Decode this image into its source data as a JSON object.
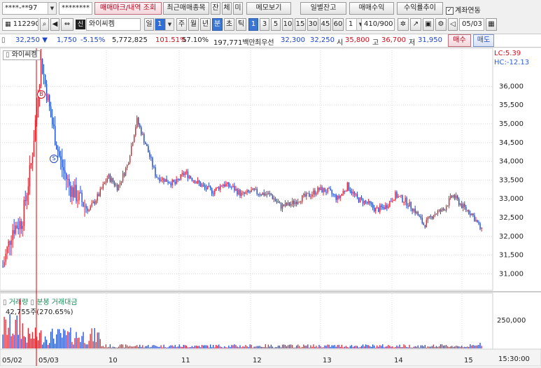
{
  "toolbar1": {
    "account": "****-**97",
    "password": "********",
    "btn_history": "매매마크/내역 조회",
    "btn_recent": "최근매매종목",
    "btn_jan": "잔",
    "btn_che": "체",
    "btn_mi": "미",
    "btn_memo": "메모보기",
    "btn_daily": "일별잔고",
    "btn_profit": "매매수익",
    "btn_return": "수익률추이",
    "chk_linked": "계좌연동"
  },
  "toolbar2": {
    "code": "112290",
    "badge": "신",
    "stock_name": "와이씨켐",
    "period_il": "일",
    "period_num": "1",
    "periods": [
      "주",
      "월",
      "년",
      "분",
      "초",
      "틱"
    ],
    "intervals": [
      "1",
      "3",
      "5",
      "10",
      "15",
      "30",
      "45",
      "60"
    ],
    "unit_value": "1",
    "count": "410/900",
    "date": "05/03"
  },
  "info": {
    "price": "32,250",
    "arrow": "▼",
    "change": "1,750",
    "pct": "-5.15%",
    "volume": "5,772,825",
    "ratio1": "101.51%",
    "ratio2": "57.10%",
    "amount": "197,771백만",
    "quote_label": "최우선",
    "ask": "32,300",
    "bid": "32,250",
    "open_label": "시",
    "open": "35,800",
    "high_label": "고",
    "high": "36,700",
    "low_label": "저",
    "low": "31,950",
    "buy_button": "매수",
    "sell_button": "매도"
  },
  "chart": {
    "stock_label": "와이씨켐",
    "lc": "LC:5.39",
    "hc": "HC:-12.13",
    "buy_marker": "B",
    "sell_marker": "S",
    "vol_label": "거래량",
    "amt_label": "분봉 거래대금",
    "vol_value": "42,755주(270.65%)",
    "vol_tick": "250,000",
    "x_last": "15:30:00"
  },
  "chart_data": {
    "type": "candlestick",
    "y_ticks": [
      31000,
      31500,
      32000,
      32500,
      33000,
      33500,
      34000,
      34500,
      35000,
      35500,
      36000
    ],
    "ylim": [
      30600,
      36900
    ],
    "x_tick_labels": [
      "05/02",
      "05/03",
      "10",
      "11",
      "12",
      "13",
      "14",
      "15"
    ],
    "price_path": [
      [
        0,
        31200
      ],
      [
        1,
        32200
      ],
      [
        2,
        32400
      ],
      [
        3,
        34000
      ],
      [
        4,
        36700
      ],
      [
        5,
        35200
      ],
      [
        6,
        34000
      ],
      [
        7,
        33300
      ],
      [
        8,
        33000
      ],
      [
        9,
        32700
      ],
      [
        10,
        33100
      ],
      [
        11,
        33600
      ],
      [
        12,
        33300
      ],
      [
        13,
        33900
      ],
      [
        14,
        35100
      ],
      [
        15,
        34400
      ],
      [
        16,
        33600
      ],
      [
        17,
        33500
      ],
      [
        18,
        33400
      ],
      [
        19,
        33700
      ],
      [
        20,
        33500
      ],
      [
        21,
        33300
      ],
      [
        22,
        33200
      ],
      [
        23,
        33400
      ],
      [
        24,
        33300
      ],
      [
        25,
        33100
      ],
      [
        26,
        33200
      ],
      [
        27,
        33150
      ],
      [
        28,
        33100
      ],
      [
        29,
        32800
      ],
      [
        30,
        32850
      ],
      [
        31,
        33000
      ],
      [
        32,
        33100
      ],
      [
        33,
        33250
      ],
      [
        34,
        33200
      ],
      [
        35,
        33000
      ],
      [
        36,
        33350
      ],
      [
        37,
        33000
      ],
      [
        38,
        32900
      ],
      [
        39,
        32700
      ],
      [
        40,
        32800
      ],
      [
        41,
        33100
      ],
      [
        42,
        32950
      ],
      [
        43,
        32700
      ],
      [
        44,
        32300
      ],
      [
        45,
        32600
      ],
      [
        46,
        32700
      ],
      [
        47,
        33100
      ],
      [
        48,
        32800
      ],
      [
        49,
        32600
      ],
      [
        50,
        32150
      ]
    ]
  }
}
